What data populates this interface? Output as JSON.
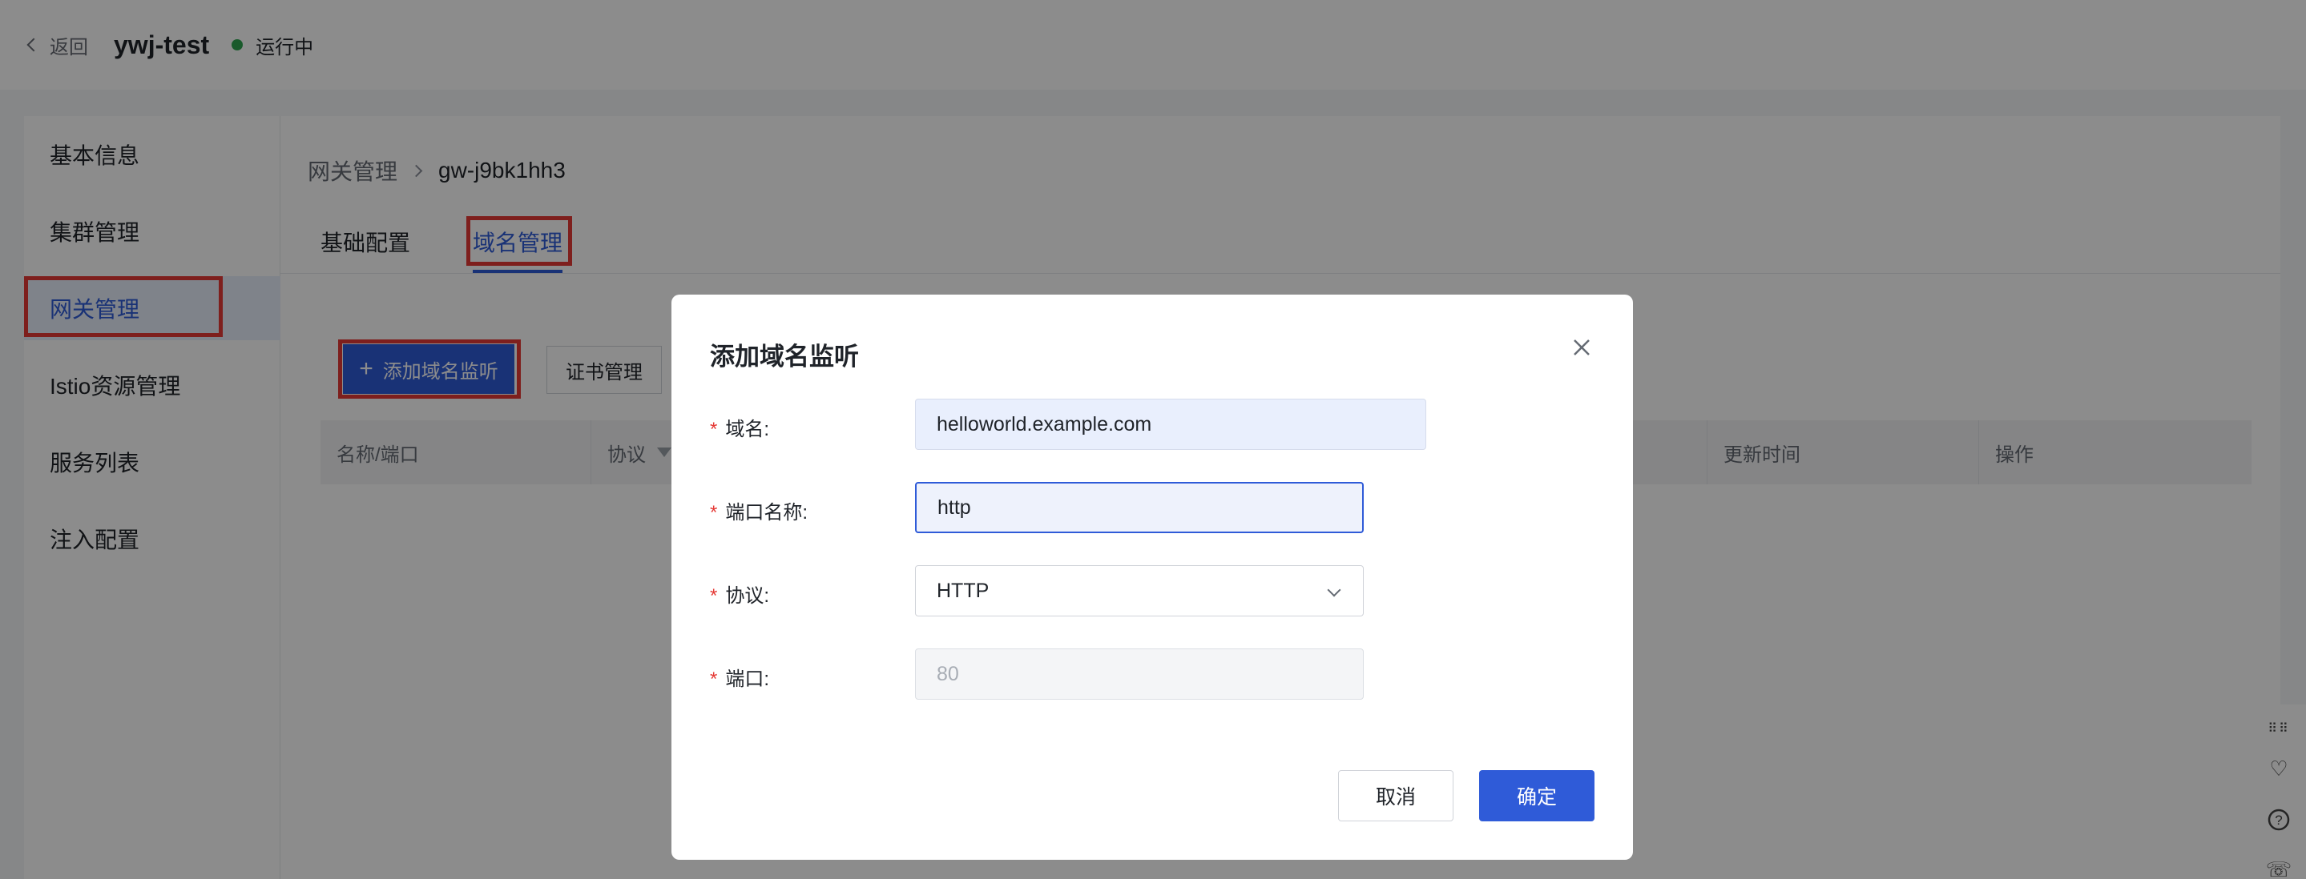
{
  "header": {
    "back_label": "返回",
    "app_name": "ywj-test",
    "status": "运行中",
    "status_color": "#2ea44f"
  },
  "sidebar": {
    "items": [
      {
        "label": "基本信息"
      },
      {
        "label": "集群管理"
      },
      {
        "label": "网关管理",
        "active": true
      },
      {
        "label": "Istio资源管理"
      },
      {
        "label": "服务列表"
      },
      {
        "label": "注入配置"
      }
    ]
  },
  "breadcrumb": {
    "parent": "网关管理",
    "current": "gw-j9bk1hh3"
  },
  "tabs": [
    {
      "label": "基础配置"
    },
    {
      "label": "域名管理",
      "active": true
    }
  ],
  "toolbar": {
    "add_label": "添加域名监听",
    "cert_label": "证书管理"
  },
  "table": {
    "columns": [
      "名称/端口",
      "协议",
      "更新时间",
      "操作"
    ]
  },
  "dialog": {
    "title": "添加域名监听",
    "fields": {
      "domain": {
        "label": "域名:",
        "value": "helloworld.example.com"
      },
      "port_name": {
        "label": "端口名称:",
        "value": "http"
      },
      "protocol": {
        "label": "协议:",
        "value": "HTTP"
      },
      "port": {
        "label": "端口:",
        "placeholder": "80"
      }
    },
    "cancel_label": "取消",
    "ok_label": "确定"
  },
  "colors": {
    "primary": "#2f5bd8",
    "highlight": "#e53935",
    "required": "#e53935"
  },
  "float_icons": [
    "drag-handle-icon",
    "heart-icon",
    "help-icon",
    "phone-icon"
  ]
}
